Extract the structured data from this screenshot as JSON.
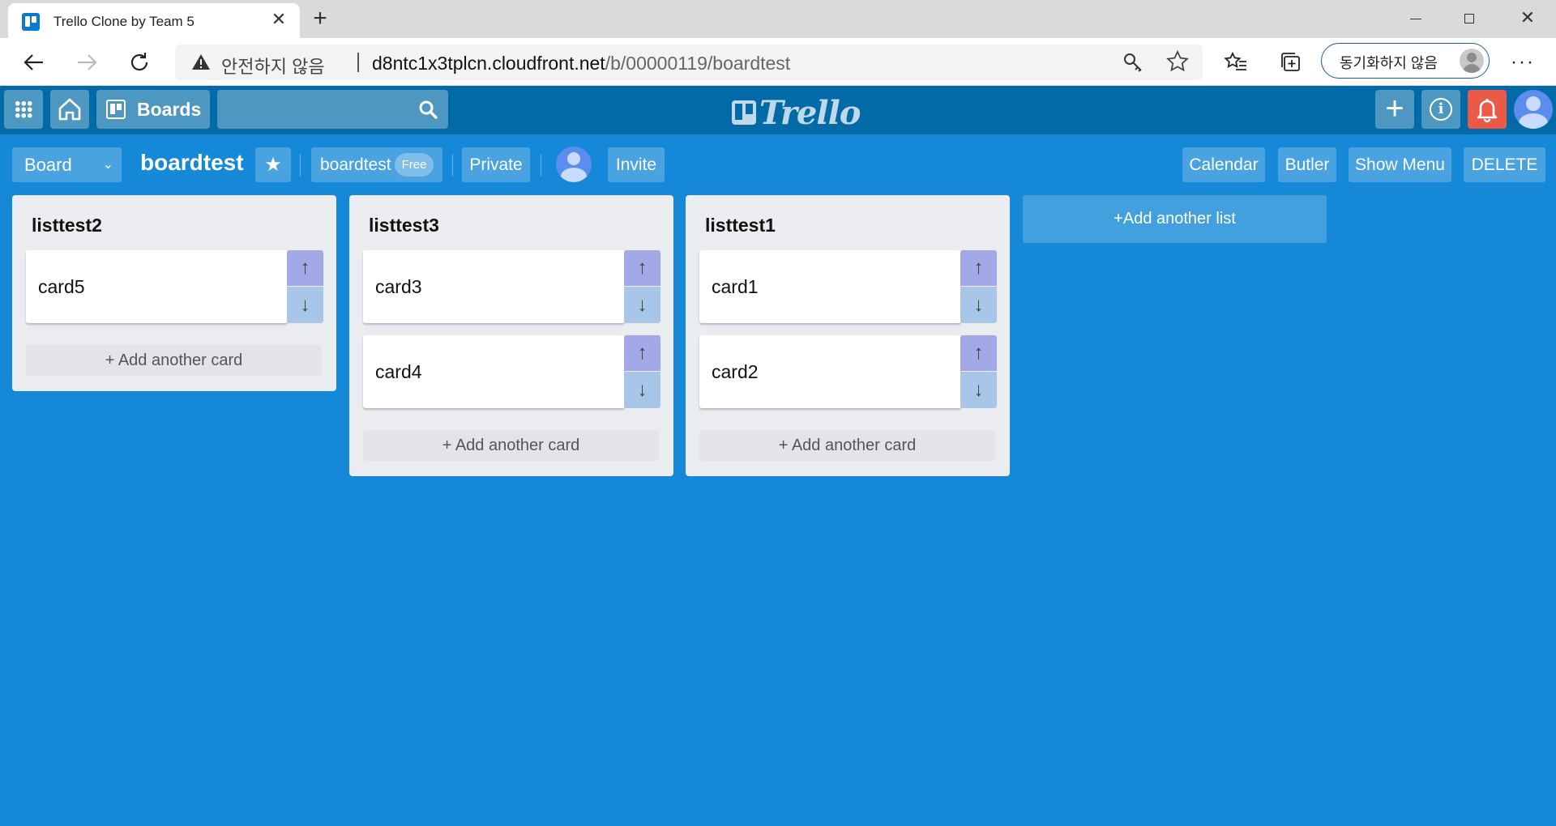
{
  "browser": {
    "tab_title": "Trello Clone by Team 5",
    "tab_close": "✕",
    "new_tab": "+",
    "window_close": "✕",
    "security_warning": "안전하지 않음",
    "url_host": "d8ntc1x3tplcn.cloudfront.net",
    "url_path": "/b/00000119/boardtest",
    "sync_label": "동기화하지 않음",
    "more_menu": "···"
  },
  "header": {
    "boards_label": "Boards",
    "logo_text": "Trello",
    "add_symbol": "+",
    "info_symbol": "i"
  },
  "board": {
    "view_select": "Board",
    "view_chevron": "⌄",
    "title": "boardtest",
    "star_symbol": "★",
    "team_name": "boardtest",
    "plan_badge": "Free",
    "visibility": "Private",
    "invite_label": "Invite",
    "calendar_label": "Calendar",
    "butler_label": "Butler",
    "show_menu_label": "Show Menu",
    "delete_label": "DELETE",
    "add_list_label": "+Add another list"
  },
  "controls": {
    "move_up": "↑",
    "move_down": "↓",
    "add_card_label": "+ Add another card"
  },
  "lists": [
    {
      "title": "listtest2",
      "cards": [
        "card5"
      ]
    },
    {
      "title": "listtest3",
      "cards": [
        "card3",
        "card4"
      ]
    },
    {
      "title": "listtest1",
      "cards": [
        "card1",
        "card2"
      ]
    }
  ],
  "colors": {
    "board_background": "#1589d8",
    "header_background": "#026aa7",
    "notification_button": "#eb5a46",
    "list_background": "#ebecf0",
    "move_up_button": "#a2a9e6",
    "move_down_button": "#a8c6e8"
  },
  "icons": {
    "tab_favicon": "trello-favicon-icon",
    "back": "arrow-left-icon",
    "forward": "arrow-right-icon",
    "reload": "reload-icon",
    "warning": "warning-triangle-icon",
    "key": "key-icon",
    "bookmark": "star-outline-icon",
    "favorites": "favorites-icon",
    "collections": "collections-icon",
    "apps": "apps-grid-icon",
    "home": "home-icon",
    "boards": "boards-icon",
    "search": "search-icon",
    "info": "info-icon",
    "notifications": "bell-icon",
    "avatar": "user-avatar-icon"
  }
}
